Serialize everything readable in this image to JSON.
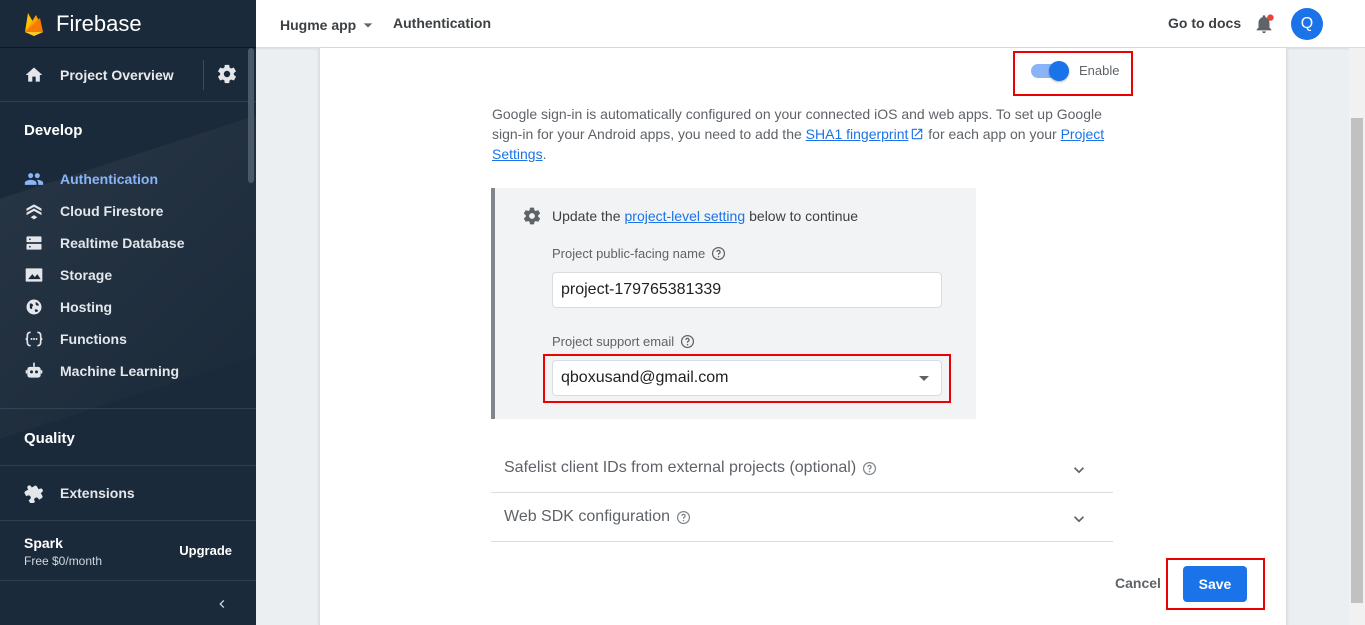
{
  "app": {
    "brand": "Firebase"
  },
  "sidebar": {
    "overview_label": "Project Overview",
    "develop_title": "Develop",
    "items": [
      {
        "label": "Authentication",
        "icon": "people-icon",
        "active": true
      },
      {
        "label": "Cloud Firestore",
        "icon": "firestore-icon"
      },
      {
        "label": "Realtime Database",
        "icon": "database-icon"
      },
      {
        "label": "Storage",
        "icon": "image-icon"
      },
      {
        "label": "Hosting",
        "icon": "globe-icon"
      },
      {
        "label": "Functions",
        "icon": "functions-icon"
      },
      {
        "label": "Machine Learning",
        "icon": "robot-icon"
      }
    ],
    "quality_title": "Quality",
    "extensions_label": "Extensions",
    "plan_name": "Spark",
    "plan_price": "Free $0/month",
    "upgrade_label": "Upgrade"
  },
  "topbar": {
    "project": "Hugme app",
    "breadcrumb": "Authentication",
    "docs_link": "Go to docs",
    "avatar_initial": "Q"
  },
  "provider": {
    "toggle_label": "Enable",
    "toggle_on": true,
    "desc_part1": "Google sign-in is automatically configured on your connected iOS and web apps. To set up Google sign-in for your Android apps, you need to add the ",
    "desc_link1": "SHA1 fingerprint",
    "desc_part2": " for each app on your ",
    "desc_link2": "Project Settings",
    "desc_part3": "."
  },
  "settings": {
    "title_prefix": "Update the",
    "title_link": "project-level setting",
    "title_suffix": "below to continue",
    "public_name_label": "Project public-facing name",
    "public_name_value": "project-179765381339",
    "support_email_label": "Project support email",
    "support_email_value": "qboxusand@gmail.com"
  },
  "expanders": {
    "safelist": "Safelist client IDs from external projects (optional)",
    "web_sdk": "Web SDK configuration"
  },
  "actions": {
    "cancel": "Cancel",
    "save": "Save"
  },
  "colors": {
    "accent": "#1a73e8",
    "sidebar_bg": "#1b2a3a",
    "highlight": "#e00000"
  }
}
